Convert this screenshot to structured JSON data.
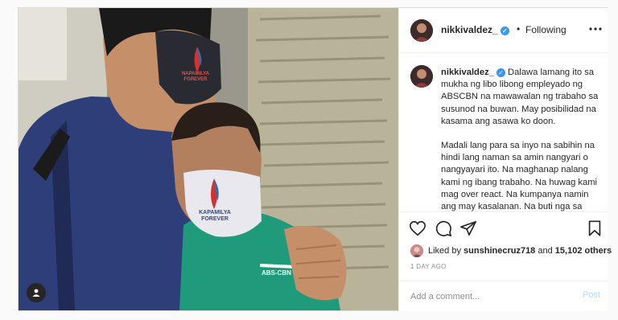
{
  "post": {
    "username": "nikkivaldez_",
    "follow_separator": "•",
    "follow_status": "Following",
    "mask_left_text": [
      "NAPAMILYA",
      "FOREVER"
    ],
    "mask_right_text": [
      "KAPAMILYA",
      "FOREVER"
    ],
    "shirt_logo": "ABS-CBN",
    "caption": {
      "username": "nikkivaldez_",
      "paragraph_1": "Dalawa lamang ito sa mukha ng libo libong empleyado ng ABSCBN na mawawalan ng trabaho sa susunod na buwan. May posibilidad na kasama ang asawa ko doon.",
      "paragraph_2": "Madali lang para sa inyo na sabihin na hindi lang naman sa amin nangyari o nangyayari ito. Na maghanap nalang kami ng ibang trabaho. Na huwag kami mag over react. Na kumpanya namin ang may kasalanan. Na buti nga sa ABSCBN magsasara na. Yung"
    },
    "likes": {
      "prefix": "Liked by",
      "user": "sunshinecruz718",
      "joiner": "and",
      "others": "15,102 others"
    },
    "time_ago": "1 DAY AGO",
    "comment": {
      "placeholder": "Add a comment...",
      "value": "",
      "post_label": "Post"
    },
    "icons": {
      "more": "more-options-icon",
      "like": "heart-icon",
      "comment": "comment-icon",
      "share": "share-icon",
      "save": "bookmark-icon",
      "tag": "user-tag-icon",
      "verified": "verified-badge-icon"
    },
    "colors": {
      "verified_blue": "#3897f0",
      "post_button_disabled": "#b3dbff",
      "meta_gray": "#8e8e8e",
      "text_dark": "#262626"
    }
  }
}
